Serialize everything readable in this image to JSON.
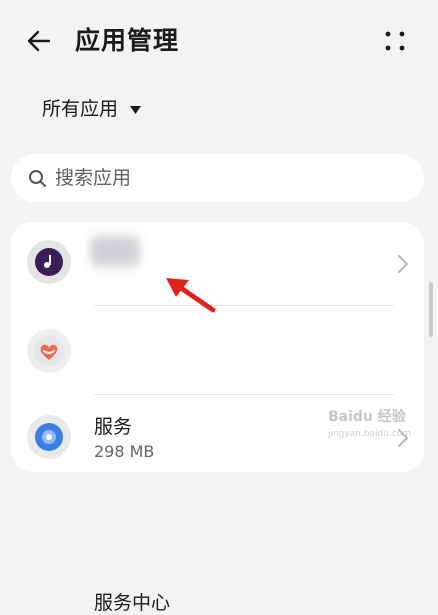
{
  "header": {
    "title": "应用管理"
  },
  "filter": {
    "label": "所有应用"
  },
  "search": {
    "placeholder": "搜索应用"
  },
  "apps": [
    {
      "name": "",
      "size": ""
    },
    {
      "name": "服务",
      "size": "298 MB"
    },
    {
      "name": "服务中心",
      "size": ""
    }
  ],
  "watermark": {
    "text": "Baidu 经验",
    "url": "jingyan.baidu.com"
  }
}
